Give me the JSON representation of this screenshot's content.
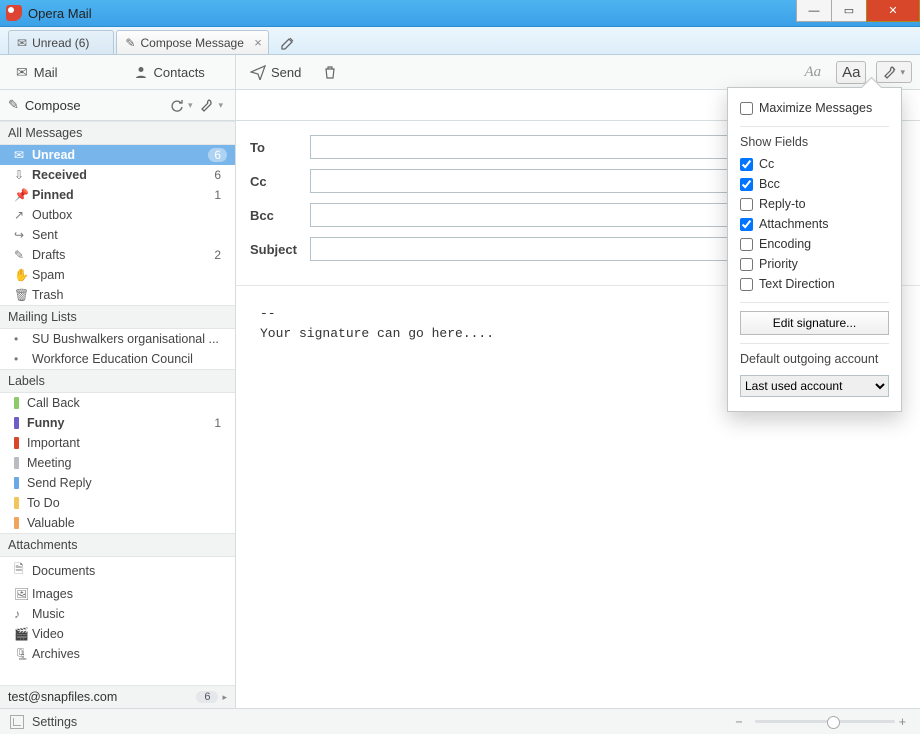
{
  "window": {
    "title": "Opera Mail"
  },
  "tabs": [
    {
      "label": "Unread (6)",
      "icon": "envelope"
    },
    {
      "label": "Compose Message",
      "icon": "compose"
    }
  ],
  "sidebarHead": {
    "mail": "Mail",
    "contacts": "Contacts"
  },
  "composeBar": {
    "label": "Compose"
  },
  "contentToolbar": {
    "send": "Send"
  },
  "sections": {
    "allMessages": {
      "title": "All Messages",
      "items": [
        {
          "label": "Unread",
          "count": "6",
          "selected": true,
          "bold": true
        },
        {
          "label": "Received",
          "count": "6",
          "bold": true
        },
        {
          "label": "Pinned",
          "count": "1",
          "bold": true
        },
        {
          "label": "Outbox"
        },
        {
          "label": "Sent"
        },
        {
          "label": "Drafts",
          "count": "2"
        },
        {
          "label": "Spam"
        },
        {
          "label": "Trash"
        }
      ]
    },
    "mailingLists": {
      "title": "Mailing Lists",
      "items": [
        {
          "label": "SU Bushwalkers organisational ..."
        },
        {
          "label": "Workforce Education Council"
        }
      ]
    },
    "labels": {
      "title": "Labels",
      "items": [
        {
          "label": "Call Back",
          "color": "#8fca6a"
        },
        {
          "label": "Funny",
          "color": "#6c5fc7",
          "count": "1",
          "bold": true
        },
        {
          "label": "Important",
          "color": "#d9472b"
        },
        {
          "label": "Meeting",
          "color": "#b9bcc0"
        },
        {
          "label": "Send Reply",
          "color": "#6aa8e6"
        },
        {
          "label": "To Do",
          "color": "#f2c55c"
        },
        {
          "label": "Valuable",
          "color": "#f0a45c"
        }
      ]
    },
    "attachments": {
      "title": "Attachments",
      "items": [
        {
          "label": "Documents"
        },
        {
          "label": "Images"
        },
        {
          "label": "Music"
        },
        {
          "label": "Video"
        },
        {
          "label": "Archives"
        }
      ]
    }
  },
  "account": {
    "email": "test@snapfiles.com",
    "count": "6"
  },
  "compose": {
    "fields": {
      "to": "To",
      "cc": "Cc",
      "bcc": "Bcc",
      "subject": "Subject"
    },
    "values": {
      "to": "",
      "cc": "",
      "bcc": "",
      "subject": ""
    },
    "body": "--\nYour signature can go here...."
  },
  "panel": {
    "maximize": "Maximize Messages",
    "showFields": "Show Fields",
    "options": {
      "cc": "Cc",
      "bcc": "Bcc",
      "replyto": "Reply-to",
      "attachments": "Attachments",
      "encoding": "Encoding",
      "priority": "Priority",
      "textdir": "Text Direction"
    },
    "checked": {
      "cc": true,
      "bcc": true,
      "replyto": false,
      "attachments": true,
      "encoding": false,
      "priority": false,
      "textdir": false
    },
    "editSig": "Edit signature...",
    "defaultOutgoing": "Default outgoing account",
    "accountSelected": "Last used account"
  },
  "statusbar": {
    "settings": "Settings"
  }
}
